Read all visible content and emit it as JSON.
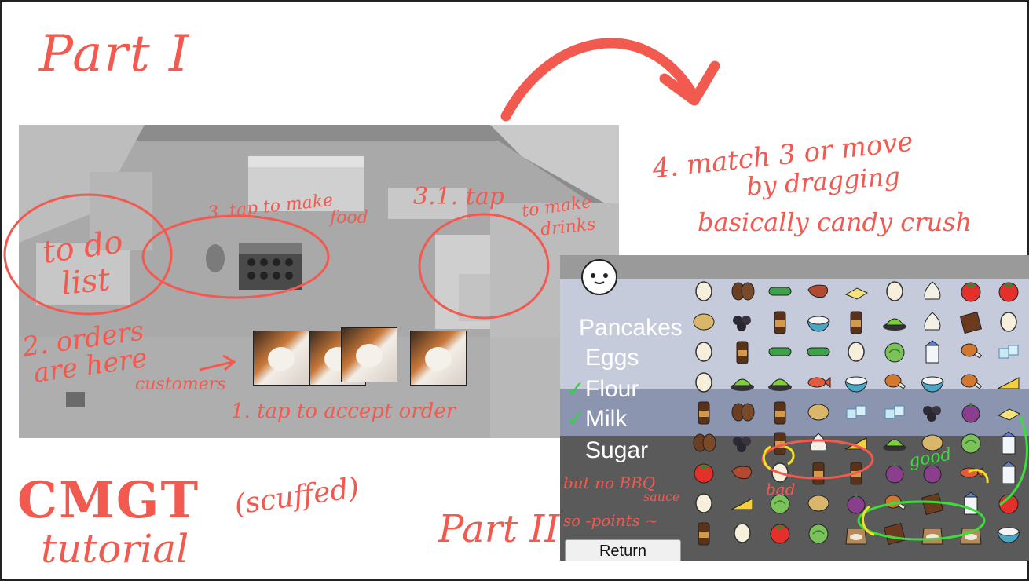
{
  "titles": {
    "part1": "Part I",
    "part2": "Part II",
    "cmgt": "CMGT",
    "tutorial": "tutorial",
    "scuffed": "(scuffed)"
  },
  "instructions": {
    "step4_line1": "4. match 3 or move",
    "step4_line2": "by dragging",
    "step4_line3": "basically candy crush",
    "step3": "3. tap to make",
    "step3_food": "food",
    "step3_1": "3.1. tap",
    "step3_1_drinks": "to make",
    "step3_1_drinks2": "drinks",
    "todo_line1": "to do",
    "todo_line2": "list",
    "orders_line1": "2. orders",
    "orders_line2": "are here",
    "customers": "customers",
    "accept": "1. tap to accept order",
    "good": "good",
    "bad": "bad",
    "bbq_line1": "but no BBQ",
    "bbq_line2": "sauce",
    "bbq_line3": "so -points ~"
  },
  "order_list": [
    {
      "label": "Pancakes",
      "checked": false
    },
    {
      "label": "Eggs",
      "checked": false
    },
    {
      "label": "Flour",
      "checked": true
    },
    {
      "label": "Milk",
      "checked": true
    },
    {
      "label": "Sugar",
      "checked": false
    }
  ],
  "check_mark": "✓",
  "return_button": "Return",
  "board": [
    [
      "egg",
      "coffee",
      "cucumber",
      "steak",
      "butter",
      "egg",
      "garlic",
      "tomato",
      "tomato"
    ],
    [
      "potato",
      "blackberry",
      "bbq",
      "rice",
      "bbq",
      "wasabi",
      "garlic",
      "chocolate",
      "egg"
    ],
    [
      "egg",
      "bbq",
      "cucumber",
      "cucumber",
      "egg",
      "cabbage",
      "milk",
      "drumstick",
      "ice"
    ],
    [
      "egg",
      "wasabi",
      "wasabi",
      "fish",
      "rice",
      "drumstick",
      "rice",
      "drumstick",
      "cheese"
    ],
    [
      "bbq",
      "coffee",
      "bbq",
      "potato",
      "ice",
      "ice",
      "blackberry",
      "onion",
      "butter"
    ],
    [
      "coffee",
      "blackberry",
      "bbq",
      "garlic",
      "cheese",
      "wasabi",
      "potato",
      "cabbage",
      "milk"
    ],
    [
      "tomato",
      "steak",
      "egg",
      "bbq",
      "bbq",
      "onion",
      "onion",
      "fish",
      "milk"
    ],
    [
      "egg",
      "cheese",
      "cabbage",
      "potato",
      "onion",
      "drumstick",
      "chocolate",
      "milk",
      "tomato"
    ],
    [
      "bbq",
      "egg",
      "tomato",
      "cabbage",
      "flour",
      "chocolate",
      "flour",
      "flour",
      "rice"
    ]
  ],
  "colors": {
    "annotation": "#f25a50",
    "highlight_yellow": "#f2e320",
    "highlight_green": "#3ddc3a",
    "check_green": "#33d04a"
  }
}
